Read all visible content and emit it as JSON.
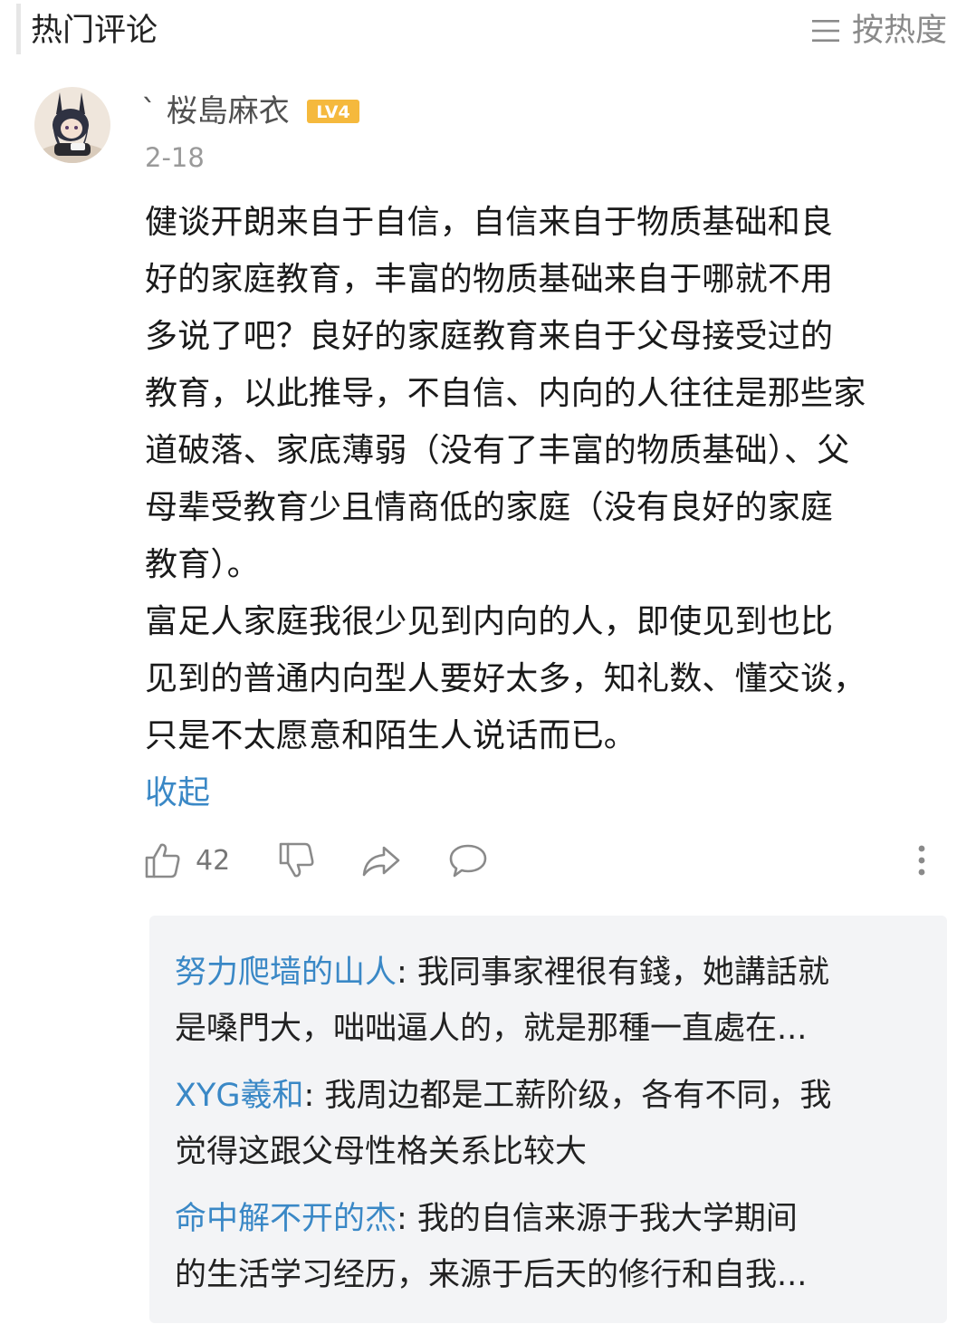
{
  "header": {
    "title": "热门评论",
    "sort_label": "按热度",
    "sort_icon": "menu-lines-icon"
  },
  "comment": {
    "avatar_icon": "anime-avatar",
    "username": "ˋ  桜島麻衣",
    "level": "LV4",
    "level_color": "#f5b93d",
    "date": "2-18",
    "paragraphs": [
      "健谈开朗来自于自信，自信来自于物质基础和良\n好的家庭教育，丰富的物质基础来自于哪就不用\n多说了吧？良好的家庭教育来自于父母接受过的\n教育，以此推导，不自信、内向的人往往是那些家\n道破落、家底薄弱（没有了丰富的物质基础）、父\n母辈受教育少且情商低的家庭（没有良好的家庭\n教育）。",
      "富足人家庭我很少见到内向的人，即使见到也比\n见到的普通内向型人要好太多，知礼数、懂交谈，\n只是不太愿意和陌生人说话而已。"
    ],
    "collapse_label": "收起",
    "like_count": "42"
  },
  "colors": {
    "link": "#3a88c6",
    "reply_bg": "#f3f4f6",
    "icon_gray": "#8a8a8a"
  },
  "replies": [
    {
      "author": "努力爬墙的山人",
      "text": ": 我同事家裡很有錢，她講話就\n是嗓門大，咄咄逼人的，就是那種一直處在..."
    },
    {
      "author": "XYG羲和",
      "text": ": 我周边都是工薪阶级，各有不同，我\n觉得这跟父母性格关系比较大"
    },
    {
      "author": "命中解不开的杰",
      "text": ": 我的自信来源于我大学期间\n的生活学习经历，来源于后天的修行和自我..."
    }
  ]
}
